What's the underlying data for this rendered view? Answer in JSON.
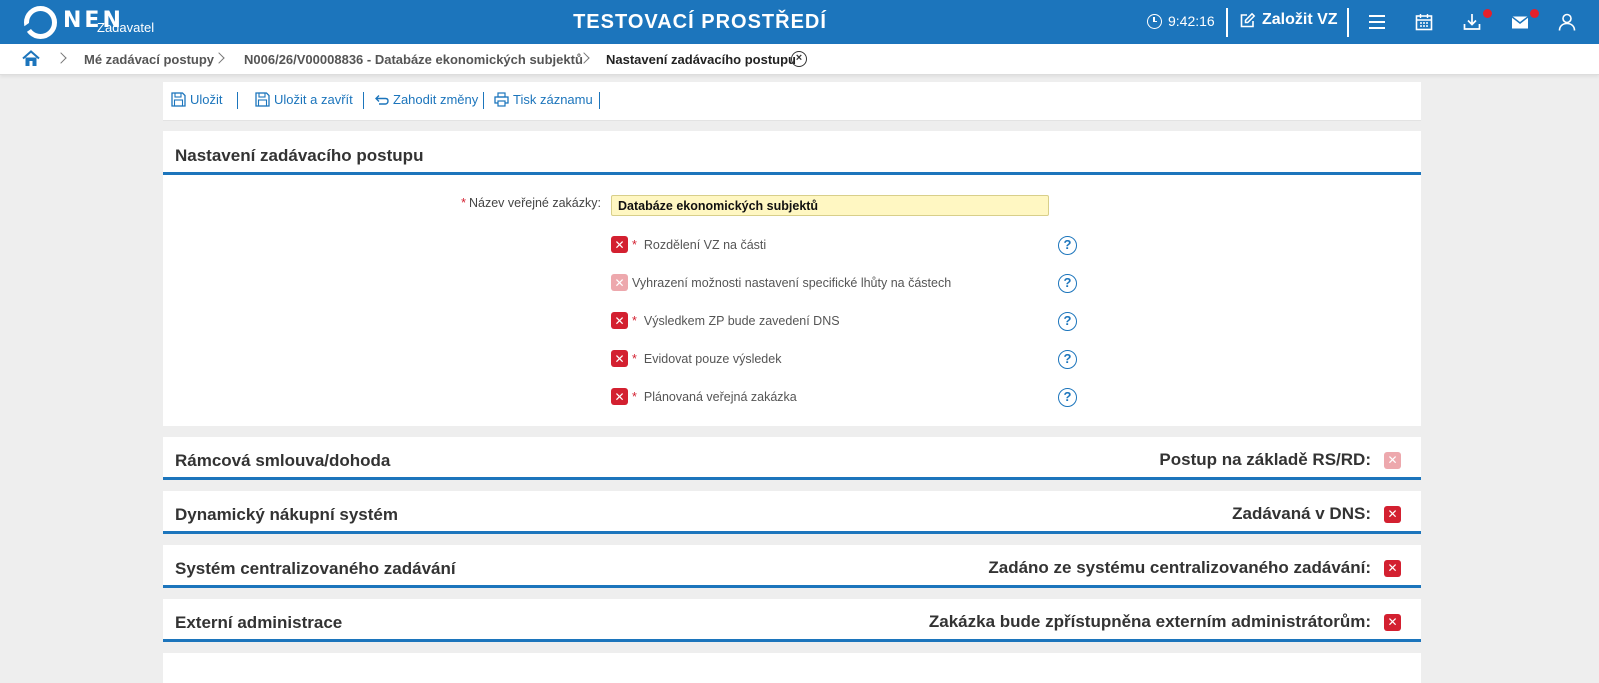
{
  "header": {
    "logo_text": "NEN",
    "logo_subtitle": "Zadavatel",
    "environment_title": "TESTOVACÍ PROSTŘEDÍ",
    "clock_time": "9:42:16",
    "create_label": "Založit VZ",
    "icons": [
      "clock-icon",
      "edit-icon",
      "menu-icon",
      "calendar-icon",
      "download-icon",
      "mail-icon",
      "user-icon"
    ],
    "accent": "#1c75bc",
    "notification_color": "#e5202b"
  },
  "breadcrumb": {
    "items": [
      "Mé zadávací postupy",
      "N006/26/V00008836 - Databáze ekonomických subjektů",
      "Nastavení zadávacího postupu"
    ]
  },
  "toolbar": {
    "save": "Uložit",
    "save_close": "Uložit a zavřít",
    "discard": "Zahodit změny",
    "print": "Tisk záznamu"
  },
  "settings": {
    "title": "Nastavení zadávacího postupu",
    "name_label": "Název veřejné zakázky:",
    "name_value": "Databáze ekonomických subjektů",
    "options": [
      {
        "label": "Rozdělení VZ na části",
        "required": true,
        "checked": false,
        "disabled": false
      },
      {
        "label": "Vyhrazení možnosti nastavení specifické lhůty na částech",
        "required": false,
        "checked": false,
        "disabled": true
      },
      {
        "label": "Výsledkem ZP bude zavedení DNS",
        "required": true,
        "checked": false,
        "disabled": false
      },
      {
        "label": "Evidovat pouze výsledek",
        "required": true,
        "checked": false,
        "disabled": false
      },
      {
        "label": "Plánovaná veřejná zakázka",
        "required": true,
        "checked": false,
        "disabled": false
      }
    ]
  },
  "sections": [
    {
      "title": "Rámcová smlouva/dohoda",
      "right_label": "Postup na základě RS/RD:",
      "disabled": true
    },
    {
      "title": "Dynamický nákupní systém",
      "right_label": "Zadávaná v DNS:",
      "disabled": false
    },
    {
      "title": "Systém centralizovaného zadávání",
      "right_label": "Zadáno ze systému centralizovaného zadávání:",
      "disabled": false
    },
    {
      "title": "Externí administrace",
      "right_label": "Zakázka bude zpřístupněna externím administrátorům:",
      "disabled": false
    }
  ]
}
